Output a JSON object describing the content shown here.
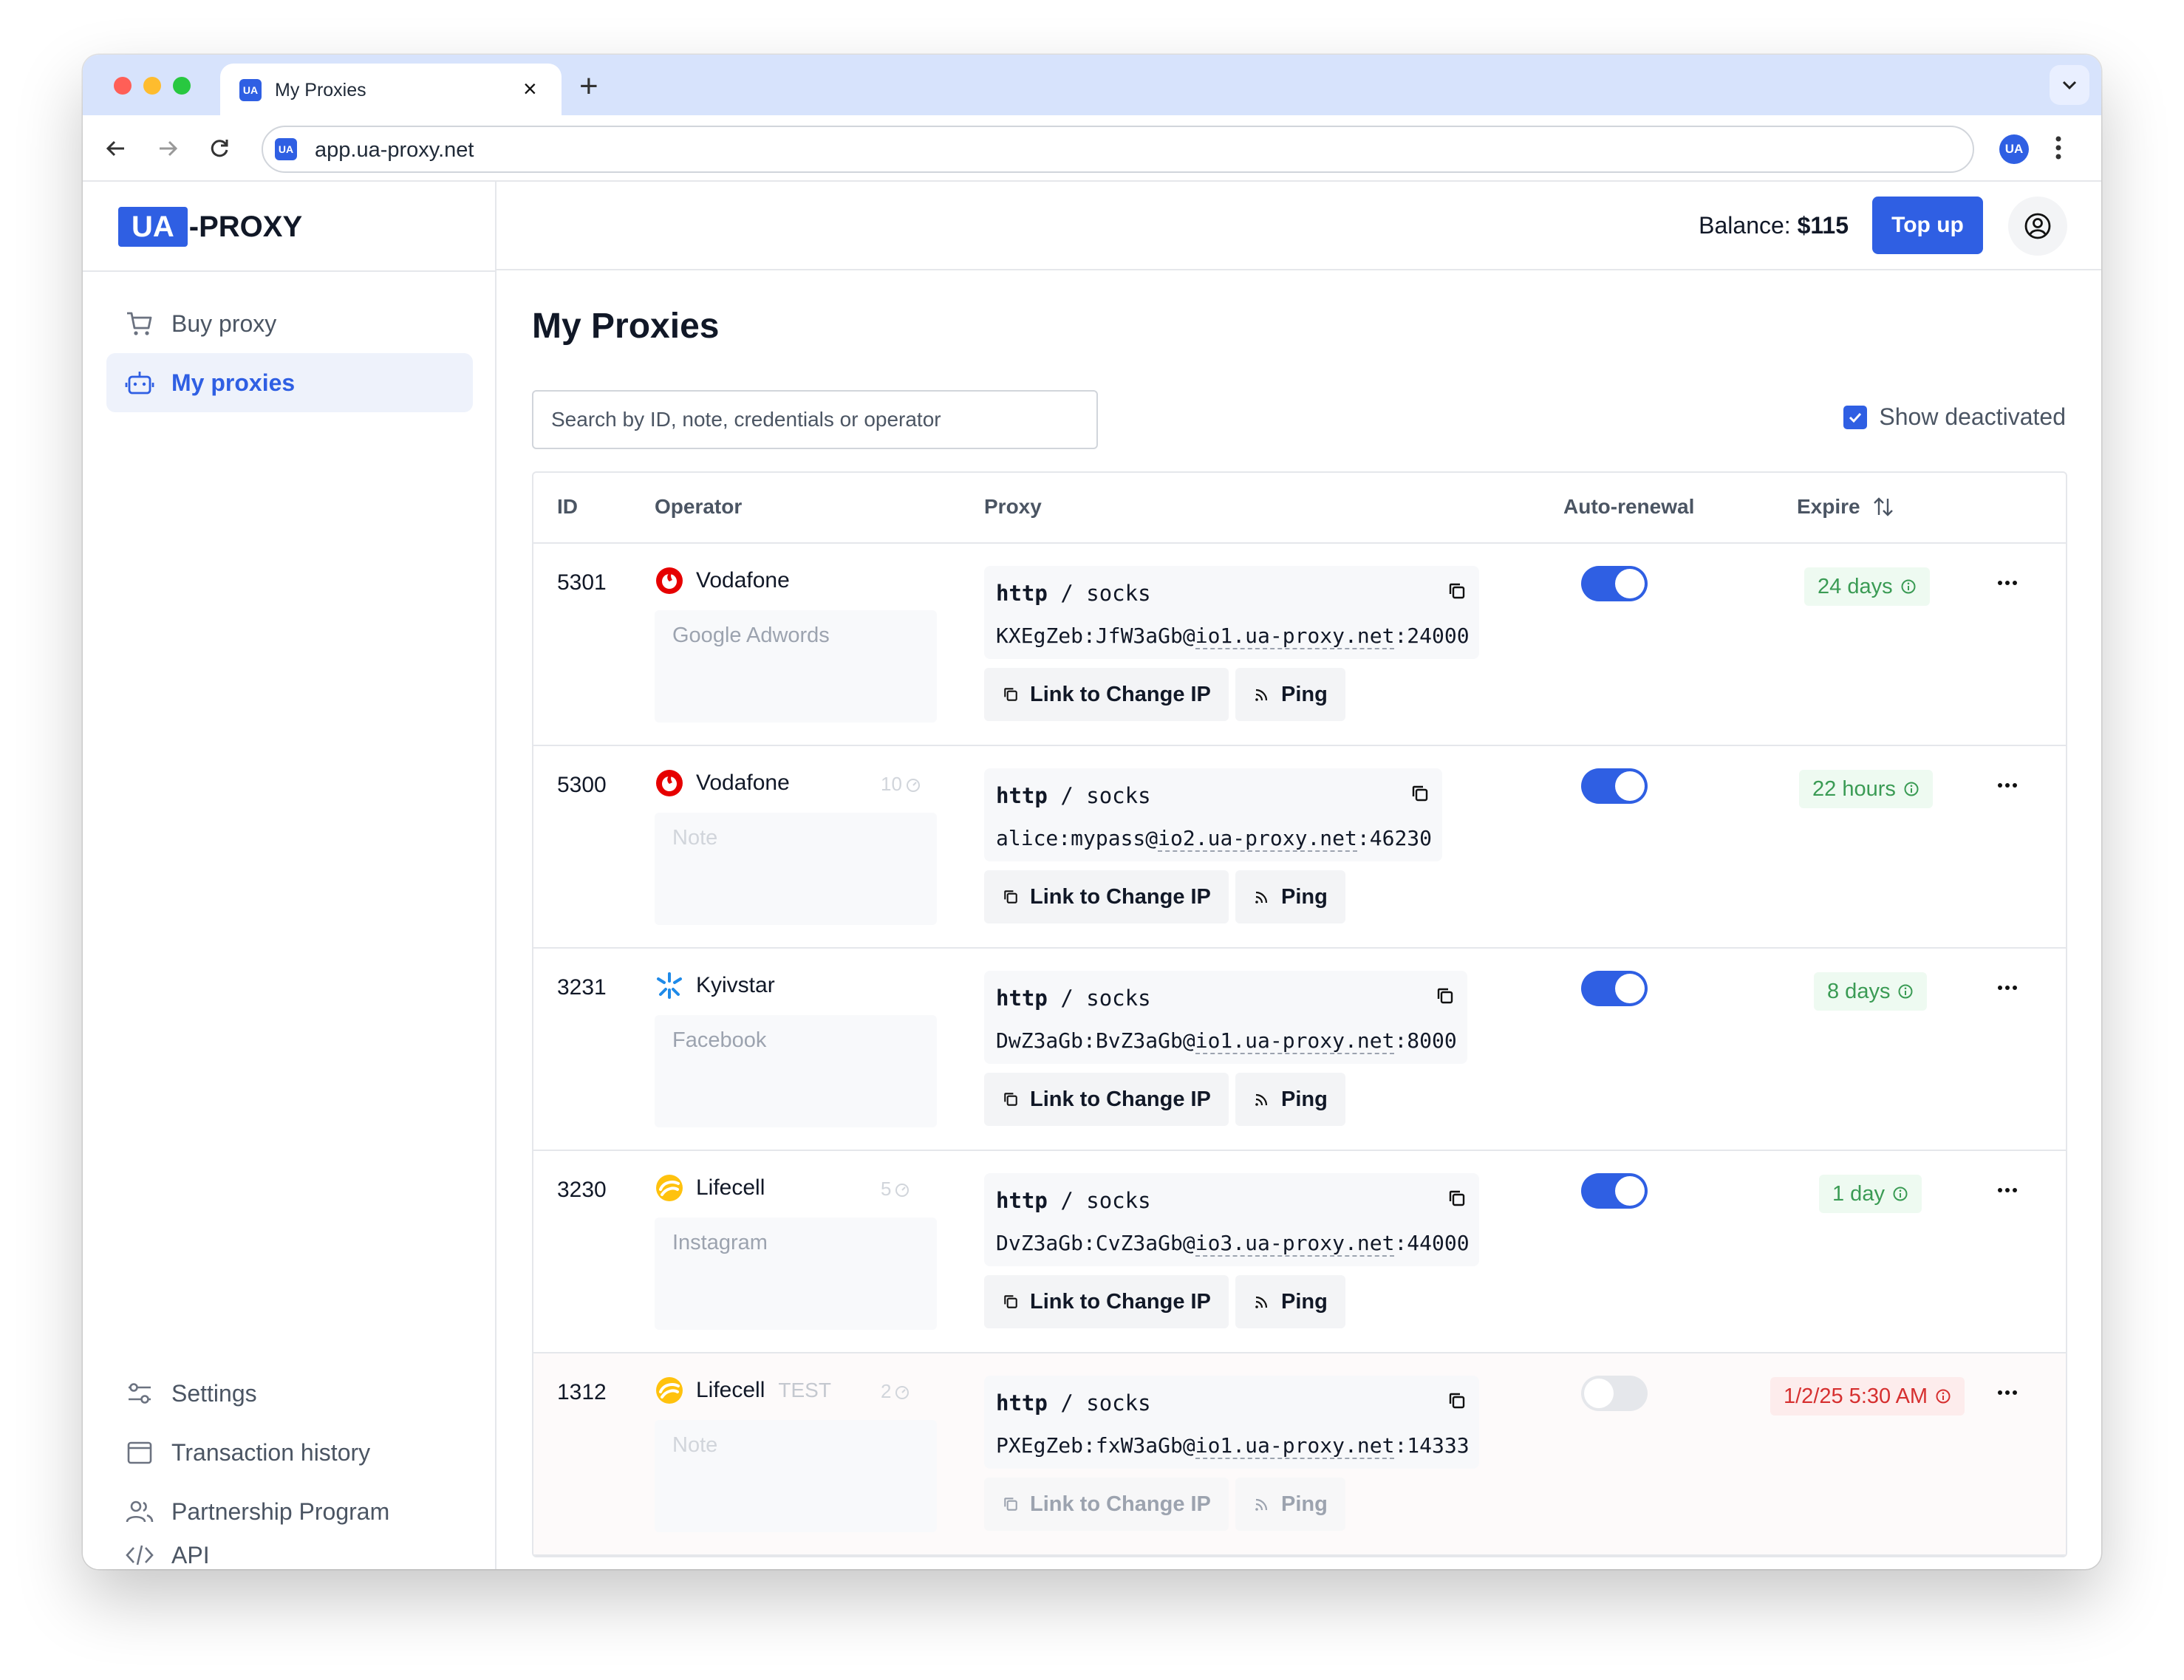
{
  "browser": {
    "tab_title": "My Proxies",
    "favicon_text": "UA",
    "url": "app.ua-proxy.net",
    "profile_initials": "UA"
  },
  "logo": {
    "ua": "UA",
    "rest": "-PROXY"
  },
  "sidebar": {
    "top_items": [
      {
        "label": "Buy proxy",
        "icon": "cart-icon",
        "active": false
      },
      {
        "label": "My proxies",
        "icon": "robot-icon",
        "active": true
      }
    ],
    "bottom_items": [
      {
        "label": "Settings",
        "icon": "sliders-icon"
      },
      {
        "label": "Transaction history",
        "icon": "wallet-icon"
      },
      {
        "label": "Partnership Program",
        "icon": "users-icon"
      },
      {
        "label": "API",
        "icon": "code-icon"
      }
    ]
  },
  "header": {
    "balance_label": "Balance:",
    "balance_value": "$115",
    "topup_label": "Top up"
  },
  "main": {
    "title": "My Proxies",
    "search_placeholder": "Search by ID, note, credentials or operator",
    "show_deactivated_label": "Show deactivated",
    "show_deactivated_checked": true,
    "columns": {
      "id": "ID",
      "operator": "Operator",
      "proxy": "Proxy",
      "auto_renewal": "Auto-renewal",
      "expire": "Expire"
    },
    "buttons": {
      "change_ip": "Link to Change IP",
      "ping": "Ping"
    },
    "rows": [
      {
        "id": "5301",
        "operator": "Vodafone",
        "operator_icon": "vodafone-logo",
        "tag": "",
        "count": "",
        "note": "Google Adwords",
        "protocol_a": "http",
        "protocol_sep": "/",
        "protocol_b": "socks",
        "creds_prefix": "KXEgZeb:JfW3aGb@",
        "host": "io1.ua-proxy.net",
        "port": ":24000",
        "auto_renewal": true,
        "expire": "24 days",
        "expire_status": "ok",
        "active": true
      },
      {
        "id": "5300",
        "operator": "Vodafone",
        "operator_icon": "vodafone-logo",
        "tag": "",
        "count": "10",
        "note": "Note",
        "protocol_a": "http",
        "protocol_sep": "/",
        "protocol_b": "socks",
        "creds_prefix": "alice:mypass@",
        "host": "io2.ua-proxy.net",
        "port": ":46230",
        "auto_renewal": true,
        "expire": "22 hours",
        "expire_status": "ok",
        "active": true
      },
      {
        "id": "3231",
        "operator": "Kyivstar",
        "operator_icon": "kyivstar-logo",
        "tag": "",
        "count": "",
        "note": "Facebook",
        "protocol_a": "http",
        "protocol_sep": "/",
        "protocol_b": "socks",
        "creds_prefix": "DwZ3aGb:BvZ3aGb@",
        "host": "io1.ua-proxy.net",
        "port": ":8000",
        "auto_renewal": true,
        "expire": "8 days",
        "expire_status": "ok",
        "active": true
      },
      {
        "id": "3230",
        "operator": "Lifecell",
        "operator_icon": "lifecell-logo",
        "tag": "",
        "count": "5",
        "note": "Instagram",
        "protocol_a": "http",
        "protocol_sep": "/",
        "protocol_b": "socks",
        "creds_prefix": "DvZ3aGb:CvZ3aGb@",
        "host": "io3.ua-proxy.net",
        "port": ":44000",
        "auto_renewal": true,
        "expire": "1 day",
        "expire_status": "ok",
        "active": true
      },
      {
        "id": "1312",
        "operator": "Lifecell",
        "operator_icon": "lifecell-logo",
        "tag": "TEST",
        "count": "2",
        "note": "Note",
        "protocol_a": "http",
        "protocol_sep": "/",
        "protocol_b": "socks",
        "creds_prefix": "PXEgZeb:fxW3aGb@",
        "host": "io1.ua-proxy.net",
        "port": ":14333",
        "auto_renewal": false,
        "expire": "1/2/25 5:30 AM",
        "expire_status": "expired",
        "active": false
      }
    ]
  },
  "colors": {
    "accent": "#2f5fe3",
    "ok": "#3a9b54",
    "danger": "#d62f2f"
  }
}
